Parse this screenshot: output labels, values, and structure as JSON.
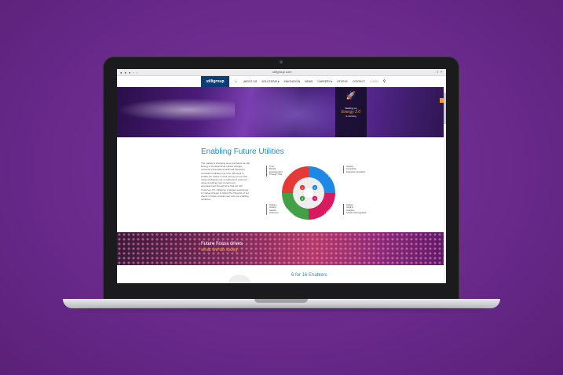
{
  "browser": {
    "url": "utiligroup.com",
    "controls": "● ● ● ‹ ›",
    "right_controls": "⇪ ＋"
  },
  "site": {
    "logo": "utiligroup",
    "nav": [
      "ABOUT US",
      "SOLUTIONS ▾",
      "INNOVATION",
      "NEWS",
      "CAREERS ▾",
      "PEOPLE",
      "CONTACT",
      "LOGIN"
    ],
    "home_icon": "home-icon",
    "search_icon": "search-icon"
  },
  "hero": {
    "promo_line1": "Building up",
    "promo_line2": "Energy 2.0",
    "promo_line3": "is Coming"
  },
  "content": {
    "title": "Enabling Future Utilities",
    "body": "The market is changing as a new basis we call Energy 2.0 customising market change, customer expectations shift and disruptive innovation building over time. We seek to enable our clients in their journey to turn this range of change into a roadmap of customer value providing trust, benefit and empowerment through time that we call Customer 2.0. Utiligroup engages seamlessly in market change to reflect the interests of our clients in these programmes and our enabling solutions.",
    "wheel_labels": [
      "Customer 2.0",
      "Change Agility",
      "Innovation",
      "Data Cohesion"
    ],
    "wheel_numbers": [
      "1",
      "2",
      "3",
      "4"
    ],
    "list_top_left": [
      "Trust",
      "Benefit",
      "Empowerment",
      "Through Time"
    ],
    "list_bottom_left": [
      "Delivery",
      "Industry",
      "Solution",
      "Outcomes"
    ],
    "list_top_right": [
      "Industry",
      "Complexity",
      "Disruptive Innovation"
    ],
    "list_bottom_right": [
      "Industry",
      "Insights",
      "Analytics",
      "Social & Demographic"
    ]
  },
  "band": {
    "line1": "Future Focus drives",
    "line2": "what we do today"
  },
  "enablers": {
    "title": "6 for 16 Enablers"
  },
  "colors": {
    "background": "#6a2a8c",
    "accent_blue": "#1a8fd0",
    "accent_orange": "#f0a030",
    "logo_navy": "#0a3d77",
    "wheel_red": "#e53935",
    "wheel_blue": "#1e88e5",
    "wheel_green": "#43a047",
    "wheel_pink": "#d81b60"
  }
}
